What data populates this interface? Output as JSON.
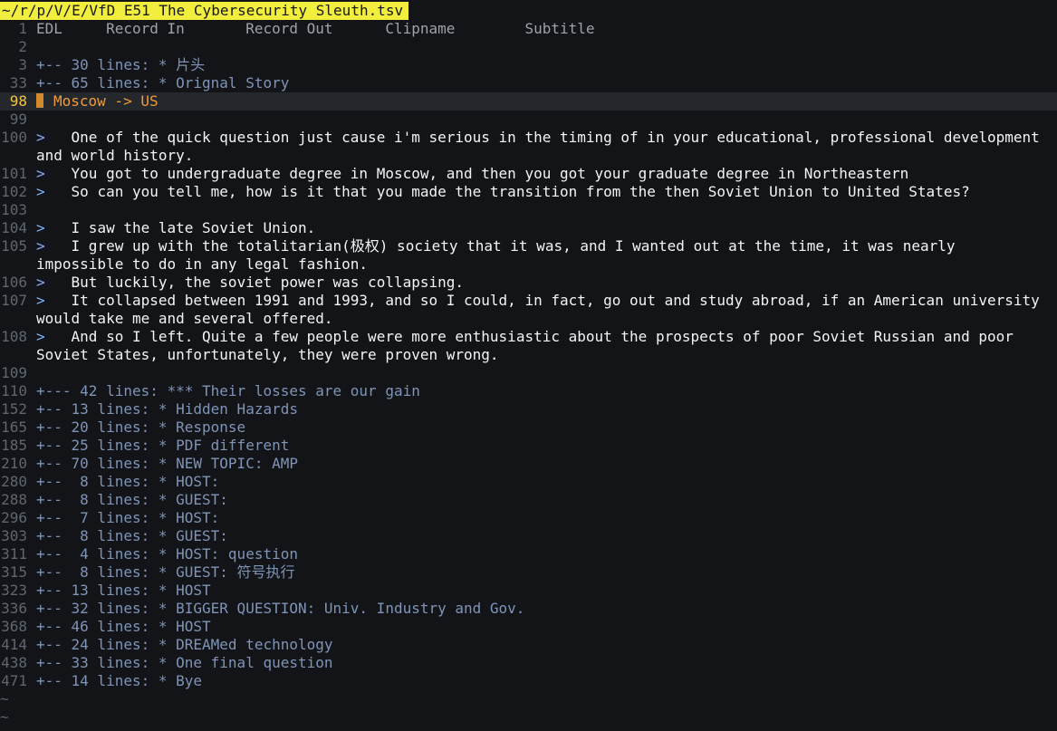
{
  "tab": {
    "title": "~/r/p/V/E/VfD E51 The Cybersecurity Sleuth.tsv"
  },
  "header_row": {
    "num": "1",
    "cols": [
      "EDL",
      "Record In",
      "Record Out",
      "Clipname",
      "Subtitle"
    ],
    "text": "EDL     Record In       Record Out      Clipname        Subtitle"
  },
  "rows": [
    {
      "num": "2",
      "kind": "empty",
      "text": ""
    },
    {
      "num": "3",
      "kind": "fold",
      "text": "+-- 30 lines: * 片头"
    },
    {
      "num": "33",
      "kind": "fold",
      "text": "+-- 65 lines: * Orignal Story"
    },
    {
      "num": "98",
      "kind": "heading",
      "text": "Moscow -> US"
    },
    {
      "num": "99",
      "kind": "empty",
      "text": ""
    },
    {
      "num": "100",
      "kind": "body",
      "marker": ">",
      "text": "   One of the quick question just cause i'm serious in the timing of in your educational, professional development and world history."
    },
    {
      "num": "101",
      "kind": "body",
      "marker": ">",
      "text": "   You got to undergraduate degree in Moscow, and then you got your graduate degree in Northeastern"
    },
    {
      "num": "102",
      "kind": "body",
      "marker": ">",
      "text": "   So can you tell me, how is it that you made the transition from the then Soviet Union to United States?"
    },
    {
      "num": "103",
      "kind": "empty",
      "text": ""
    },
    {
      "num": "104",
      "kind": "body",
      "marker": ">",
      "text": "   I saw the late Soviet Union."
    },
    {
      "num": "105",
      "kind": "body",
      "marker": ">",
      "text": "   I grew up with the totalitarian(极权) society that it was, and I wanted out at the time, it was nearly impossible to do in any legal fashion."
    },
    {
      "num": "106",
      "kind": "body",
      "marker": ">",
      "text": "   But luckily, the soviet power was collapsing."
    },
    {
      "num": "107",
      "kind": "body",
      "marker": ">",
      "text": "   It collapsed between 1991 and 1993, and so I could, in fact, go out and study abroad, if an American university would take me and several offered."
    },
    {
      "num": "108",
      "kind": "body",
      "marker": ">",
      "text": "   And so I left. Quite a few people were more enthusiastic about the prospects of poor Soviet Russian and poor Soviet States, unfortunately, they were proven wrong."
    },
    {
      "num": "109",
      "kind": "empty",
      "text": ""
    },
    {
      "num": "110",
      "kind": "fold",
      "text": "+--- 42 lines: *** Their losses are our gain"
    },
    {
      "num": "152",
      "kind": "fold",
      "text": "+-- 13 lines: * Hidden Hazards"
    },
    {
      "num": "165",
      "kind": "fold",
      "text": "+-- 20 lines: * Response"
    },
    {
      "num": "185",
      "kind": "fold",
      "text": "+-- 25 lines: * PDF different"
    },
    {
      "num": "210",
      "kind": "fold",
      "text": "+-- 70 lines: * NEW TOPIC: AMP"
    },
    {
      "num": "280",
      "kind": "fold",
      "text": "+--  8 lines: * HOST:"
    },
    {
      "num": "288",
      "kind": "fold",
      "text": "+--  8 lines: * GUEST:"
    },
    {
      "num": "296",
      "kind": "fold",
      "text": "+--  7 lines: * HOST:"
    },
    {
      "num": "303",
      "kind": "fold",
      "text": "+--  8 lines: * GUEST:"
    },
    {
      "num": "311",
      "kind": "fold",
      "text": "+--  4 lines: * HOST: question"
    },
    {
      "num": "315",
      "kind": "fold",
      "text": "+--  8 lines: * GUEST: 符号执行"
    },
    {
      "num": "323",
      "kind": "fold",
      "text": "+-- 13 lines: * HOST"
    },
    {
      "num": "336",
      "kind": "fold",
      "text": "+-- 32 lines: * BIGGER QUESTION: Univ. Industry and Gov."
    },
    {
      "num": "368",
      "kind": "fold",
      "text": "+-- 46 lines: * HOST"
    },
    {
      "num": "414",
      "kind": "fold",
      "text": "+-- 24 lines: * DREAMed technology"
    },
    {
      "num": "438",
      "kind": "fold",
      "text": "+-- 33 lines: * One final question"
    },
    {
      "num": "471",
      "kind": "fold",
      "text": "+-- 14 lines: * Bye"
    }
  ],
  "tildes": [
    "~",
    "~"
  ],
  "colors": {
    "background": "#121418",
    "tabline": "#f2ee3d",
    "fold": "#7f94b7",
    "body": "#f2f4f5",
    "linenr": "#5f6670",
    "current_linenr": "#f3c63e",
    "heading": "#f19a3a",
    "cursor": "#d38a2c",
    "quote_marker": "#7fb0ff"
  }
}
